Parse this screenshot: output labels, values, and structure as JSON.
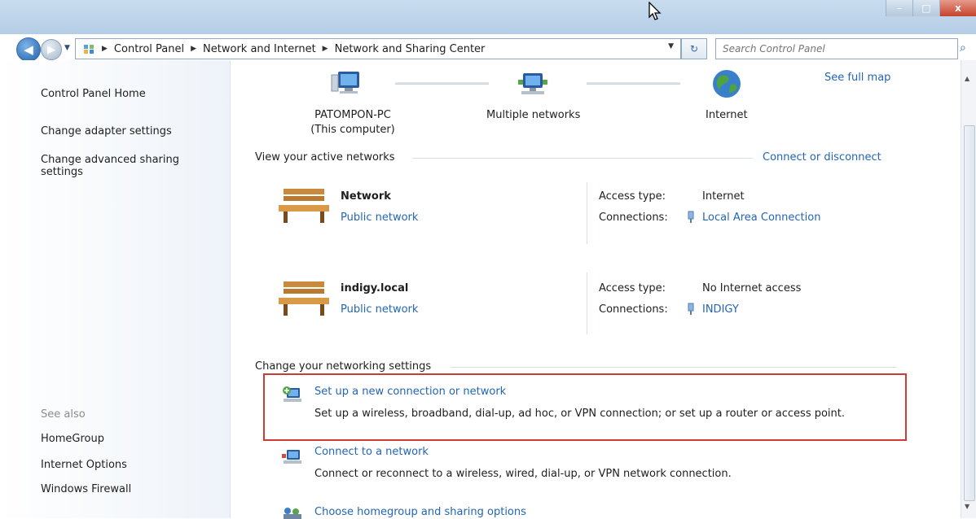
{
  "window": {
    "minimize_label": "–",
    "maximize_label": "□",
    "close_label": "x"
  },
  "address": {
    "breadcrumbs": [
      "Control Panel",
      "Network and Internet",
      "Network and Sharing Center"
    ],
    "search_placeholder": "Search Control Panel"
  },
  "sidebar": {
    "home": "Control Panel Home",
    "adapter": "Change adapter settings",
    "advanced_line1": "Change advanced sharing",
    "advanced_line2": "settings",
    "see_also": "See also",
    "homegroup": "HomeGroup",
    "internet_options": "Internet Options",
    "firewall": "Windows Firewall"
  },
  "map": {
    "computer_name": "PATOMPON-PC",
    "computer_sub": "(This computer)",
    "networks": "Multiple networks",
    "internet": "Internet",
    "see_full_map": "See full map"
  },
  "active": {
    "heading": "View your active networks",
    "connect_link": "Connect or disconnect",
    "access_label": "Access type:",
    "connections_label": "Connections:",
    "networks": [
      {
        "name": "Network",
        "type": "Public network",
        "access": "Internet",
        "connection": "Local Area Connection"
      },
      {
        "name": "indigy.local",
        "type": "Public network",
        "access": "No Internet access",
        "connection": "INDIGY"
      }
    ]
  },
  "settings": {
    "heading": "Change your networking settings",
    "tasks": [
      {
        "title": "Set up a new connection or network",
        "desc": "Set up a wireless, broadband, dial-up, ad hoc, or VPN connection; or set up a router or access point."
      },
      {
        "title": "Connect to a network",
        "desc": "Connect or reconnect to a wireless, wired, dial-up, or VPN network connection."
      },
      {
        "title": "Choose homegroup and sharing options",
        "desc": ""
      }
    ]
  },
  "colors": {
    "link": "#2365b6",
    "highlight_border": "#cc3c32"
  }
}
